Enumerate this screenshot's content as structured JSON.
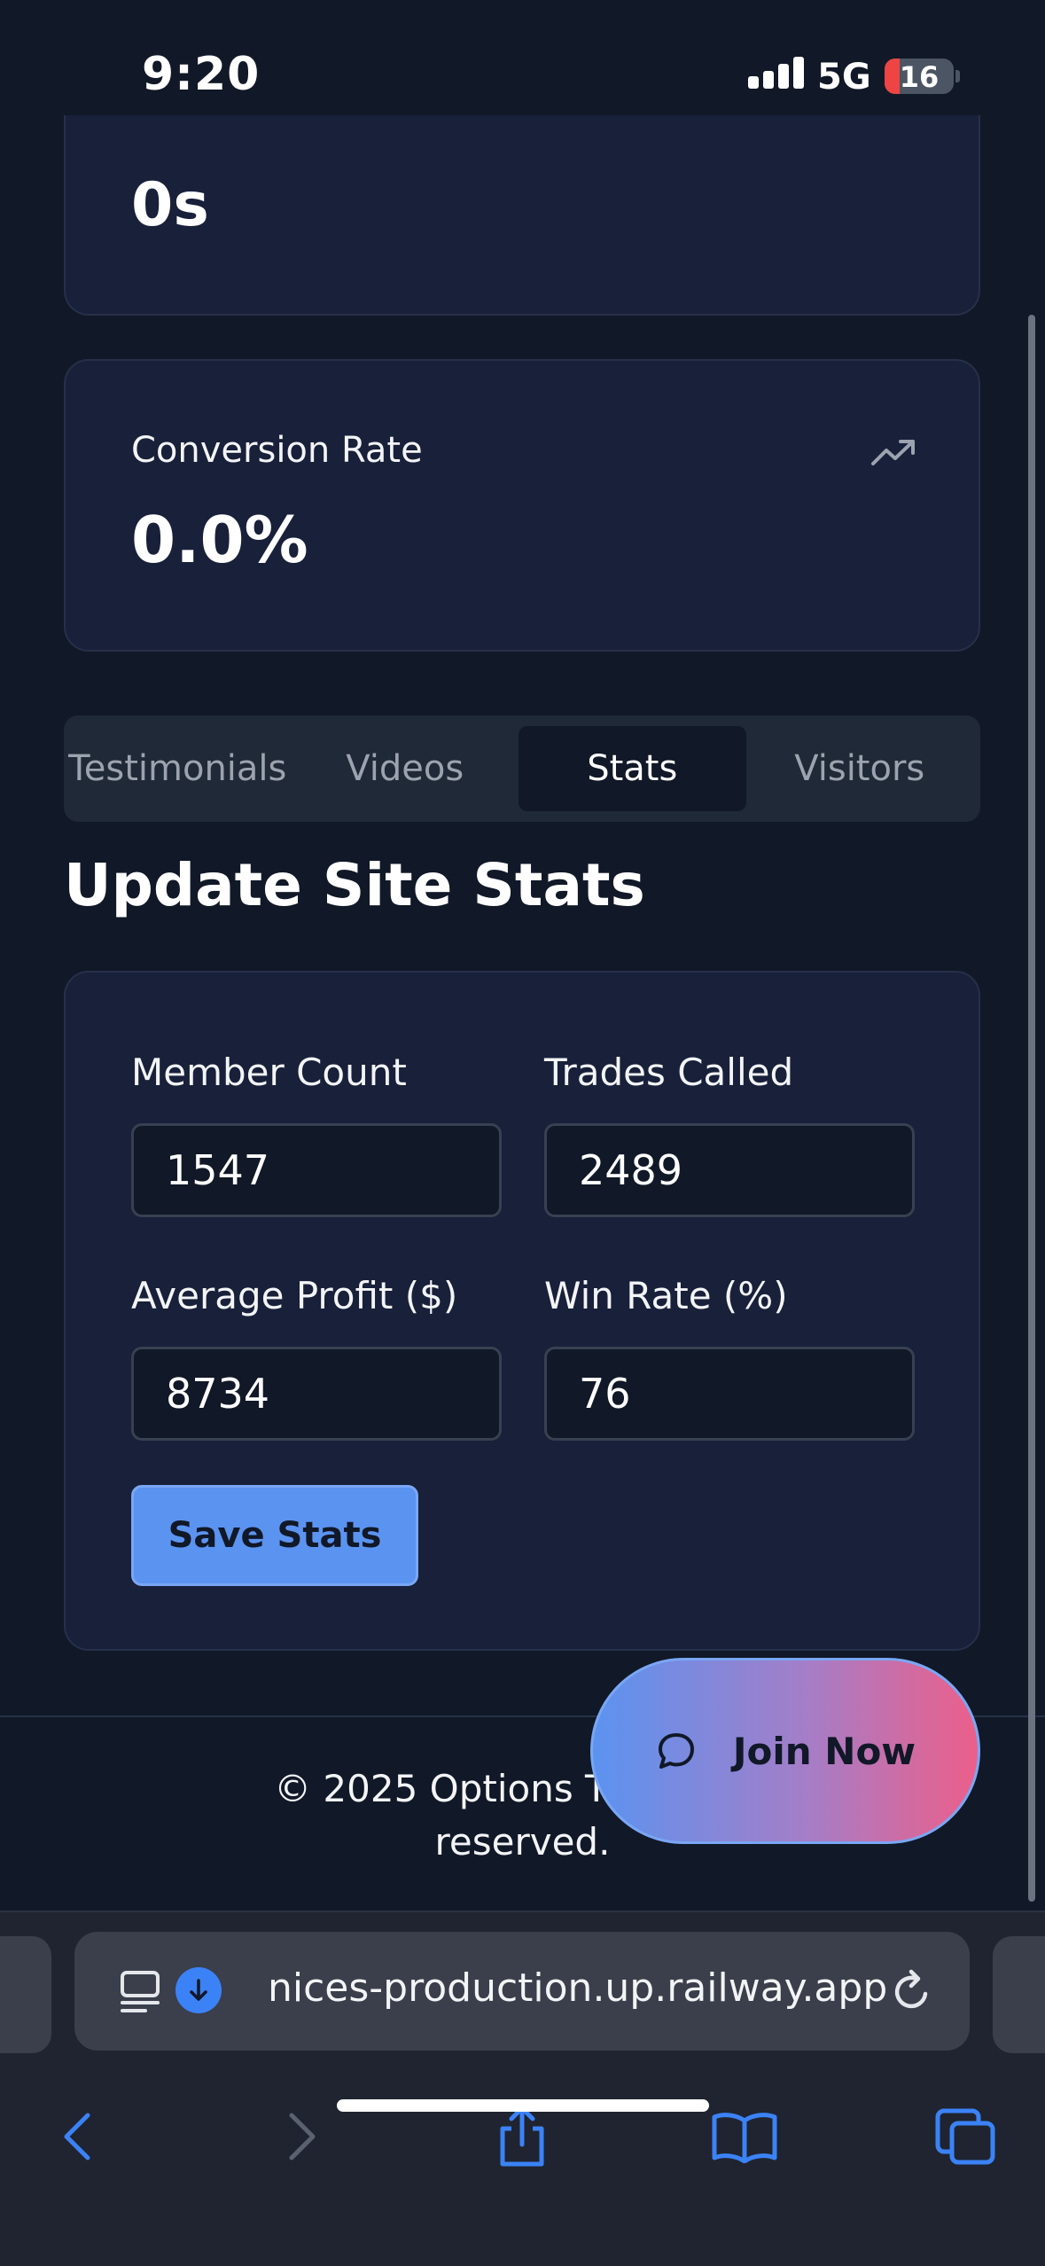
{
  "status_bar": {
    "time": "9:20",
    "network": "5G",
    "battery": "16"
  },
  "sessions_card": {
    "value": "0s"
  },
  "conversion_card": {
    "label": "Conversion Rate",
    "value": "0.0%",
    "icon": "trending-up-icon"
  },
  "tabs": [
    {
      "label": "Testimonials",
      "active": false
    },
    {
      "label": "Videos",
      "active": false
    },
    {
      "label": "Stats",
      "active": true
    },
    {
      "label": "Visitors",
      "active": false
    }
  ],
  "section_title": "Update Site Stats",
  "form": {
    "member_count": {
      "label": "Member Count",
      "value": "1547"
    },
    "trades_called": {
      "label": "Trades Called",
      "value": "2489"
    },
    "average_profit": {
      "label": "Average Profit ($)",
      "value": "8734"
    },
    "win_rate": {
      "label": "Win Rate (%)",
      "value": "76"
    },
    "save_label": "Save Stats"
  },
  "footer": {
    "line1": "© 2025 Options Trading Ul",
    "line2": "reserved."
  },
  "join_button": {
    "label": "Join Now",
    "icon": "chat-bubble-icon"
  },
  "browser": {
    "url": "nices-production.up.railway.app",
    "icons": [
      "page-menu-icon",
      "download-icon",
      "reload-icon",
      "back-icon",
      "forward-icon",
      "share-icon",
      "bookmarks-icon",
      "tabs-icon"
    ]
  },
  "colors": {
    "background": "#111827",
    "card": "#18203a",
    "accent": "#5b93f0",
    "gradient_end": "#ec5f8a"
  }
}
